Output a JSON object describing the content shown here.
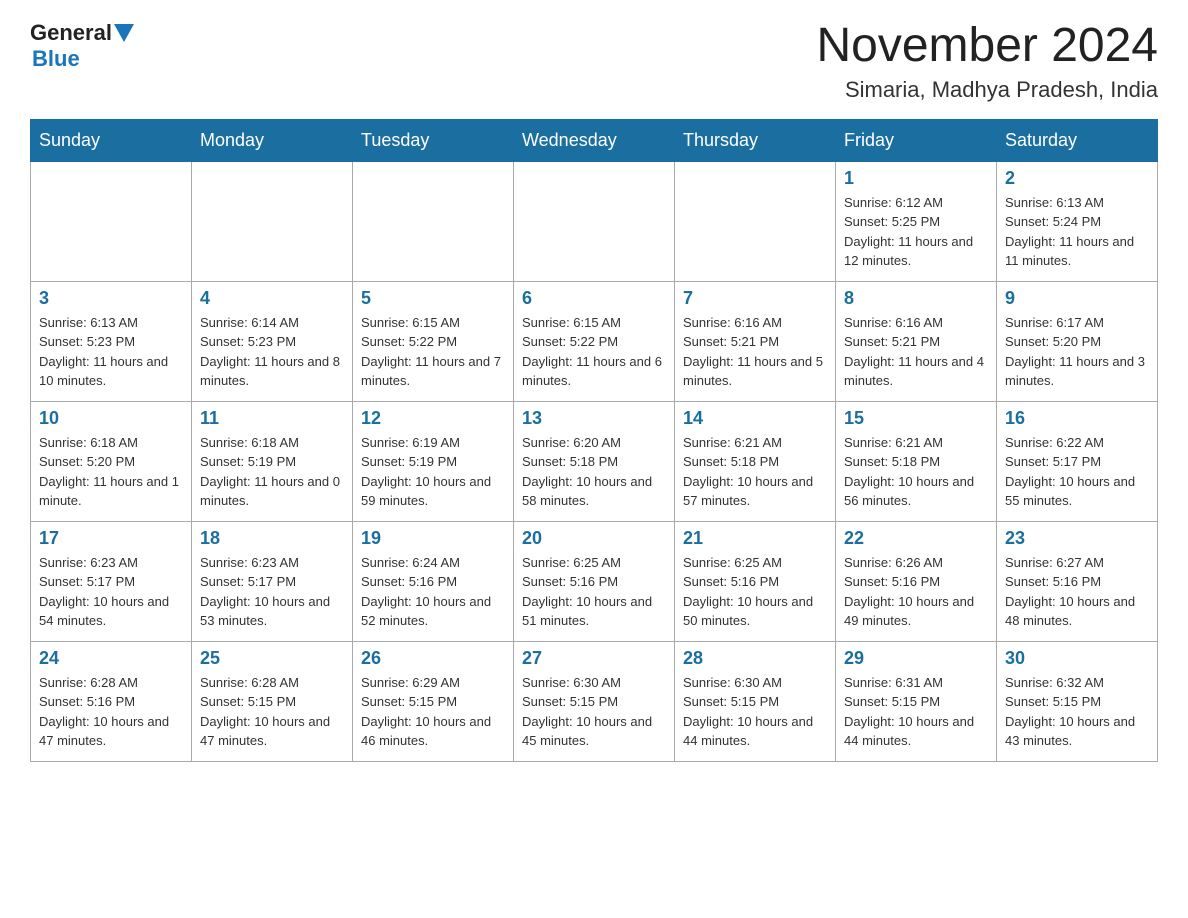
{
  "header": {
    "logo_general": "General",
    "logo_blue": "Blue",
    "month_title": "November 2024",
    "location": "Simaria, Madhya Pradesh, India"
  },
  "days_of_week": [
    "Sunday",
    "Monday",
    "Tuesday",
    "Wednesday",
    "Thursday",
    "Friday",
    "Saturday"
  ],
  "weeks": [
    [
      {
        "day": "",
        "info": ""
      },
      {
        "day": "",
        "info": ""
      },
      {
        "day": "",
        "info": ""
      },
      {
        "day": "",
        "info": ""
      },
      {
        "day": "",
        "info": ""
      },
      {
        "day": "1",
        "info": "Sunrise: 6:12 AM\nSunset: 5:25 PM\nDaylight: 11 hours and 12 minutes."
      },
      {
        "day": "2",
        "info": "Sunrise: 6:13 AM\nSunset: 5:24 PM\nDaylight: 11 hours and 11 minutes."
      }
    ],
    [
      {
        "day": "3",
        "info": "Sunrise: 6:13 AM\nSunset: 5:23 PM\nDaylight: 11 hours and 10 minutes."
      },
      {
        "day": "4",
        "info": "Sunrise: 6:14 AM\nSunset: 5:23 PM\nDaylight: 11 hours and 8 minutes."
      },
      {
        "day": "5",
        "info": "Sunrise: 6:15 AM\nSunset: 5:22 PM\nDaylight: 11 hours and 7 minutes."
      },
      {
        "day": "6",
        "info": "Sunrise: 6:15 AM\nSunset: 5:22 PM\nDaylight: 11 hours and 6 minutes."
      },
      {
        "day": "7",
        "info": "Sunrise: 6:16 AM\nSunset: 5:21 PM\nDaylight: 11 hours and 5 minutes."
      },
      {
        "day": "8",
        "info": "Sunrise: 6:16 AM\nSunset: 5:21 PM\nDaylight: 11 hours and 4 minutes."
      },
      {
        "day": "9",
        "info": "Sunrise: 6:17 AM\nSunset: 5:20 PM\nDaylight: 11 hours and 3 minutes."
      }
    ],
    [
      {
        "day": "10",
        "info": "Sunrise: 6:18 AM\nSunset: 5:20 PM\nDaylight: 11 hours and 1 minute."
      },
      {
        "day": "11",
        "info": "Sunrise: 6:18 AM\nSunset: 5:19 PM\nDaylight: 11 hours and 0 minutes."
      },
      {
        "day": "12",
        "info": "Sunrise: 6:19 AM\nSunset: 5:19 PM\nDaylight: 10 hours and 59 minutes."
      },
      {
        "day": "13",
        "info": "Sunrise: 6:20 AM\nSunset: 5:18 PM\nDaylight: 10 hours and 58 minutes."
      },
      {
        "day": "14",
        "info": "Sunrise: 6:21 AM\nSunset: 5:18 PM\nDaylight: 10 hours and 57 minutes."
      },
      {
        "day": "15",
        "info": "Sunrise: 6:21 AM\nSunset: 5:18 PM\nDaylight: 10 hours and 56 minutes."
      },
      {
        "day": "16",
        "info": "Sunrise: 6:22 AM\nSunset: 5:17 PM\nDaylight: 10 hours and 55 minutes."
      }
    ],
    [
      {
        "day": "17",
        "info": "Sunrise: 6:23 AM\nSunset: 5:17 PM\nDaylight: 10 hours and 54 minutes."
      },
      {
        "day": "18",
        "info": "Sunrise: 6:23 AM\nSunset: 5:17 PM\nDaylight: 10 hours and 53 minutes."
      },
      {
        "day": "19",
        "info": "Sunrise: 6:24 AM\nSunset: 5:16 PM\nDaylight: 10 hours and 52 minutes."
      },
      {
        "day": "20",
        "info": "Sunrise: 6:25 AM\nSunset: 5:16 PM\nDaylight: 10 hours and 51 minutes."
      },
      {
        "day": "21",
        "info": "Sunrise: 6:25 AM\nSunset: 5:16 PM\nDaylight: 10 hours and 50 minutes."
      },
      {
        "day": "22",
        "info": "Sunrise: 6:26 AM\nSunset: 5:16 PM\nDaylight: 10 hours and 49 minutes."
      },
      {
        "day": "23",
        "info": "Sunrise: 6:27 AM\nSunset: 5:16 PM\nDaylight: 10 hours and 48 minutes."
      }
    ],
    [
      {
        "day": "24",
        "info": "Sunrise: 6:28 AM\nSunset: 5:16 PM\nDaylight: 10 hours and 47 minutes."
      },
      {
        "day": "25",
        "info": "Sunrise: 6:28 AM\nSunset: 5:15 PM\nDaylight: 10 hours and 47 minutes."
      },
      {
        "day": "26",
        "info": "Sunrise: 6:29 AM\nSunset: 5:15 PM\nDaylight: 10 hours and 46 minutes."
      },
      {
        "day": "27",
        "info": "Sunrise: 6:30 AM\nSunset: 5:15 PM\nDaylight: 10 hours and 45 minutes."
      },
      {
        "day": "28",
        "info": "Sunrise: 6:30 AM\nSunset: 5:15 PM\nDaylight: 10 hours and 44 minutes."
      },
      {
        "day": "29",
        "info": "Sunrise: 6:31 AM\nSunset: 5:15 PM\nDaylight: 10 hours and 44 minutes."
      },
      {
        "day": "30",
        "info": "Sunrise: 6:32 AM\nSunset: 5:15 PM\nDaylight: 10 hours and 43 minutes."
      }
    ]
  ]
}
